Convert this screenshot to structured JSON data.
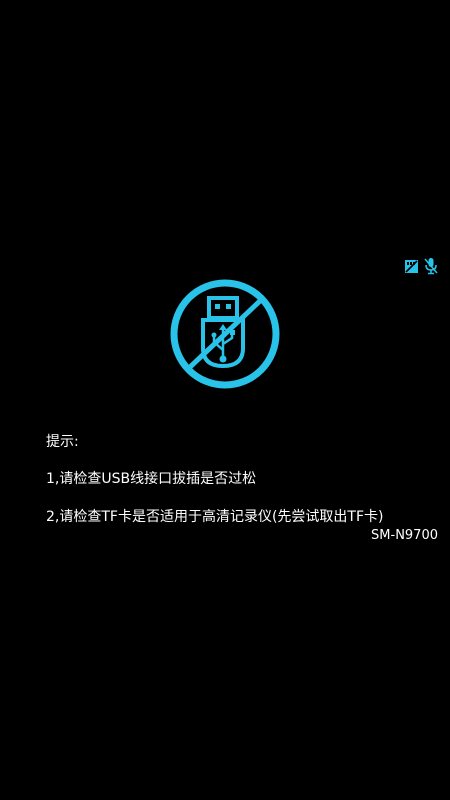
{
  "status_icons": [
    {
      "icon": "sd-card-off-icon"
    },
    {
      "icon": "mic-off-icon"
    }
  ],
  "main_icon": {
    "icon": "usb-disconnected-icon",
    "color": "#29c3ea"
  },
  "tips": {
    "title": "提示:",
    "line1": "1,请检查USB线接口拔插是否过松",
    "line2": "2,请检查TF卡是否适用于高清记录仪(先尝试取出TF卡)"
  },
  "device": {
    "model": "SM-N9700"
  },
  "colors": {
    "background": "#000000",
    "accent": "#29c3ea",
    "text": "#ffffff"
  }
}
